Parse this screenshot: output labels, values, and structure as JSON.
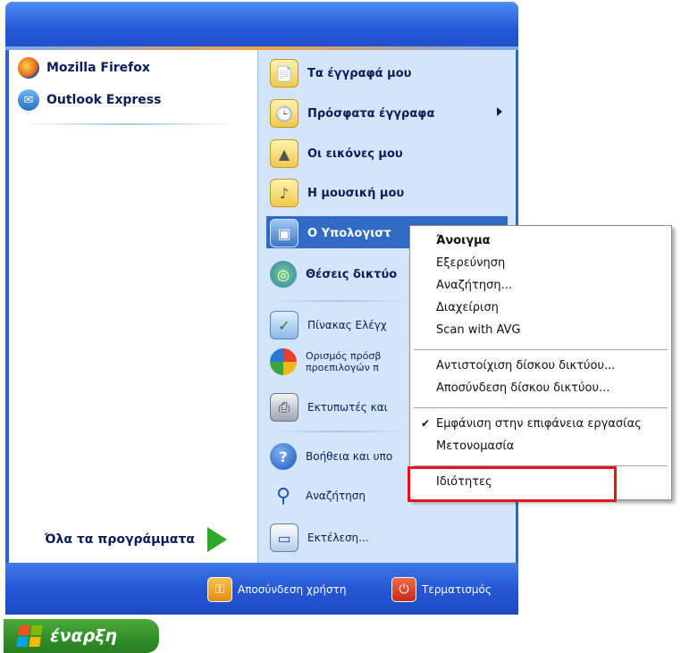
{
  "left_pinned": [
    {
      "label": "Mozilla Firefox",
      "icon": "firefox-icon"
    },
    {
      "label": "Outlook Express",
      "icon": "outlook-express-icon"
    }
  ],
  "all_programs": {
    "label": "Όλα τα προγράμματα",
    "icon": "green-arrow-icon"
  },
  "right_items": [
    {
      "label": "Τα έγγραφά μου",
      "icon": "my-documents-icon"
    },
    {
      "label": "Πρόσφατα έγγραφα",
      "icon": "recent-documents-icon"
    },
    {
      "label": "Οι εικόνες μου",
      "icon": "my-pictures-icon"
    },
    {
      "label": "Η μουσική μου",
      "icon": "my-music-icon"
    },
    {
      "label": "Ο Υπολογιστ",
      "icon": "my-computer-icon"
    },
    {
      "label": "Θέσεις δικτύο",
      "icon": "network-places-icon"
    },
    {
      "label": "Πίνακας Ελέγχ",
      "icon": "control-panel-icon"
    },
    {
      "label_line1": "Ορισμός πρόσβ",
      "label_line2": "προεπιλογών π",
      "icon": "program-access-icon"
    },
    {
      "label": "Εκτυπωτές και ",
      "icon": "printers-icon"
    },
    {
      "label": "Βοήθεια και υπο",
      "icon": "help-icon"
    },
    {
      "label": "Αναζήτηση",
      "icon": "search-icon"
    },
    {
      "label": "Εκτέλεση...",
      "icon": "run-icon"
    }
  ],
  "bottom": {
    "logoff": {
      "label": "Αποσύνδεση χρήστη",
      "icon": "logoff-key-icon"
    },
    "shutdown": {
      "label": "Τερματισμός",
      "icon": "power-icon"
    }
  },
  "start_button": {
    "label": "έναρξη",
    "icon": "windows-flag-icon"
  },
  "context_menu": {
    "open": "Άνοιγμα",
    "explore": "Εξερεύνηση",
    "search": "Αναζήτηση...",
    "manage": "Διαχείριση",
    "scan": "Scan with AVG",
    "map_drive": "Αντιστοίχιση δίσκου δικτύου...",
    "disconnect_drive": "Αποσύνδεση δίσκου δικτύου...",
    "show_desktop": "Εμφάνιση στην επιφάνεια εργασίας",
    "show_desktop_checked": "✔",
    "rename": "Μετονομασία",
    "properties": "Ιδιότητες"
  },
  "colors": {
    "highlight_box": "#e5131a",
    "menu_blue": "#2457d4",
    "selection": "#316ac5",
    "start_green": "#2f8e26"
  }
}
